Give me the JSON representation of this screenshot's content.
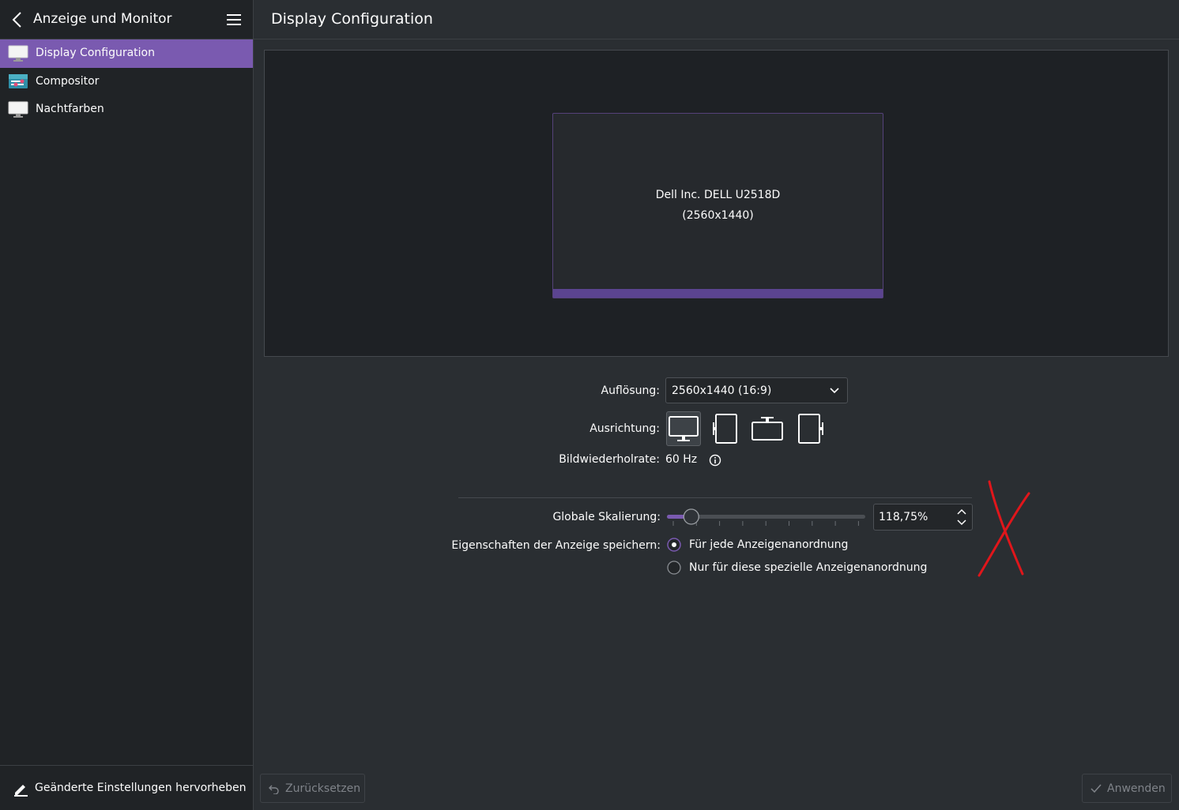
{
  "sidebar": {
    "title": "Anzeige und Monitor",
    "items": [
      {
        "label": "Display Configuration",
        "icon": "monitor-icon",
        "active": true
      },
      {
        "label": "Compositor",
        "icon": "compositor-icon",
        "active": false
      },
      {
        "label": "Nachtfarben",
        "icon": "monitor-icon",
        "active": false
      }
    ],
    "footer_label": "Geänderte Einstellungen hervorheben"
  },
  "main": {
    "title": "Display Configuration",
    "monitor": {
      "name": "Dell Inc. DELL U2518D",
      "resolution": "(2560x1440)"
    },
    "resolution_label": "Auflösung:",
    "resolution_value": "2560x1440 (16:9)",
    "orientation_label": "Ausrichtung:",
    "refresh_label": "Bildwiederholrate:",
    "refresh_value": "60 Hz",
    "scale_label": "Globale Skalierung:",
    "scale_value": "118,75%",
    "scale_slider_fraction": 0.09,
    "save_label": "Eigenschaften der Anzeige speichern:",
    "save_options": [
      {
        "label": "Für jede Anzeigenanordnung",
        "checked": true
      },
      {
        "label": "Nur für diese spezielle Anzeigenanordnung",
        "checked": false
      }
    ]
  },
  "footer": {
    "reset_label": "Zurücksetzen",
    "apply_label": "Anwenden"
  },
  "colors": {
    "accent": "#7a5ab0",
    "background": "#2a2e32",
    "sidebar": "#202326",
    "annotation": "#e0161b"
  }
}
